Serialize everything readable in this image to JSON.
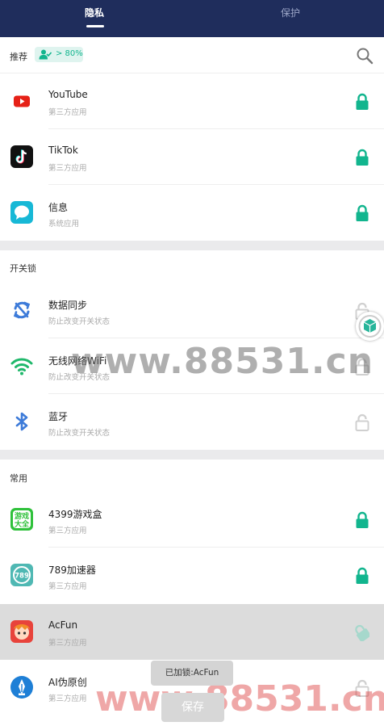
{
  "tabs": {
    "privacy": "隐私",
    "protect": "保护"
  },
  "recommend": {
    "label": "推荐",
    "badge_text": "> 80%"
  },
  "groups": {
    "recommended_apps": [
      {
        "name": "YouTube",
        "type": "第三方应用",
        "locked": true,
        "icon": "youtube-icon"
      },
      {
        "name": "TikTok",
        "type": "第三方应用",
        "locked": true,
        "icon": "tiktok-icon"
      },
      {
        "name": "信息",
        "type": "系统应用",
        "locked": true,
        "icon": "messages-icon"
      }
    ],
    "switch_lock": {
      "label": "开关锁",
      "items": [
        {
          "name": "数据同步",
          "desc": "防止改变开关状态",
          "locked": false,
          "icon": "sync-icon"
        },
        {
          "name": "无线网络WiFi",
          "desc": "防止改变开关状态",
          "locked": false,
          "icon": "wifi-icon"
        },
        {
          "name": "蓝牙",
          "desc": "防止改变开关状态",
          "locked": false,
          "icon": "bluetooth-icon"
        }
      ]
    },
    "common": {
      "label": "常用",
      "items": [
        {
          "name": "4399游戏盒",
          "type": "第三方应用",
          "locked": true,
          "icon": "game-box-icon",
          "icon_text": "游戏大全"
        },
        {
          "name": "789加速器",
          "type": "第三方应用",
          "locked": true,
          "icon": "accelerator-icon",
          "icon_text": "789"
        },
        {
          "name": "AcFun",
          "type": "第三方应用",
          "locked": true,
          "icon": "acfun-icon"
        },
        {
          "name": "AI伪原创",
          "type": "第三方应用",
          "locked": false,
          "icon": "ai-pen-icon"
        }
      ]
    }
  },
  "watermarks": [
    "www.88531.cn",
    "www.88531.cn"
  ],
  "toast": "已加锁:AcFun",
  "save_label": "保存",
  "colors": {
    "header": "#1f2d5c",
    "accent": "#12b58e",
    "unlocked": "#d0d0d0"
  }
}
